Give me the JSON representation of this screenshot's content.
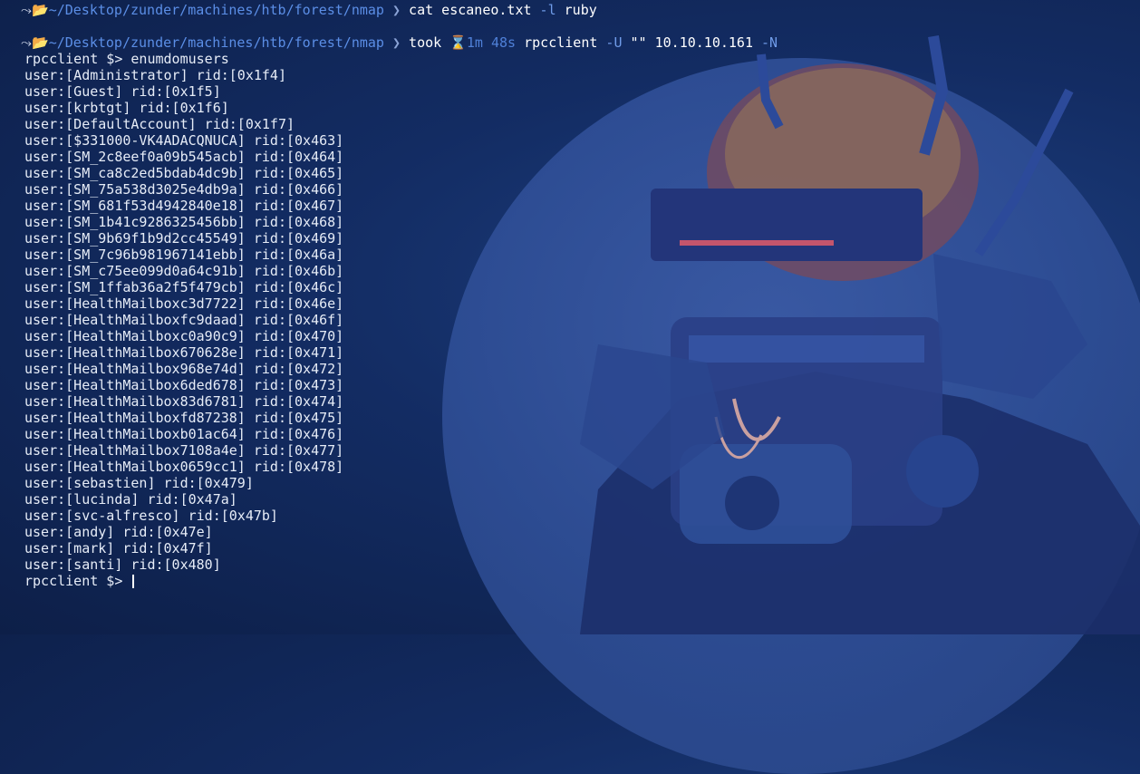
{
  "prompt": {
    "icon": "⤳📂",
    "path": "~/Desktop/zunder/machines/htb/forest/nmap",
    "chevron": "❯"
  },
  "commands": [
    {
      "name": "cat",
      "args": "escaneo.txt",
      "flag": "-l",
      "flag_value": "ruby"
    },
    {
      "took_label": "took",
      "hourglass": "⌛",
      "duration": "1m 48s",
      "name": "rpcclient",
      "flag1": "-U",
      "arg1": "\"\"",
      "ip": "10.10.10.161",
      "flag2": "-N"
    }
  ],
  "rpc_prompt": "rpcclient $>",
  "rpc_command": "enumdomusers",
  "users": [
    "user:[Administrator] rid:[0x1f4]",
    "user:[Guest] rid:[0x1f5]",
    "user:[krbtgt] rid:[0x1f6]",
    "user:[DefaultAccount] rid:[0x1f7]",
    "user:[$331000-VK4ADACQNUCA] rid:[0x463]",
    "user:[SM_2c8eef0a09b545acb] rid:[0x464]",
    "user:[SM_ca8c2ed5bdab4dc9b] rid:[0x465]",
    "user:[SM_75a538d3025e4db9a] rid:[0x466]",
    "user:[SM_681f53d4942840e18] rid:[0x467]",
    "user:[SM_1b41c9286325456bb] rid:[0x468]",
    "user:[SM_9b69f1b9d2cc45549] rid:[0x469]",
    "user:[SM_7c96b981967141ebb] rid:[0x46a]",
    "user:[SM_c75ee099d0a64c91b] rid:[0x46b]",
    "user:[SM_1ffab36a2f5f479cb] rid:[0x46c]",
    "user:[HealthMailboxc3d7722] rid:[0x46e]",
    "user:[HealthMailboxfc9daad] rid:[0x46f]",
    "user:[HealthMailboxc0a90c9] rid:[0x470]",
    "user:[HealthMailbox670628e] rid:[0x471]",
    "user:[HealthMailbox968e74d] rid:[0x472]",
    "user:[HealthMailbox6ded678] rid:[0x473]",
    "user:[HealthMailbox83d6781] rid:[0x474]",
    "user:[HealthMailboxfd87238] rid:[0x475]",
    "user:[HealthMailboxb01ac64] rid:[0x476]",
    "user:[HealthMailbox7108a4e] rid:[0x477]",
    "user:[HealthMailbox0659cc1] rid:[0x478]",
    "user:[sebastien] rid:[0x479]",
    "user:[lucinda] rid:[0x47a]",
    "user:[svc-alfresco] rid:[0x47b]",
    "user:[andy] rid:[0x47e]",
    "user:[mark] rid:[0x47f]",
    "user:[santi] rid:[0x480]"
  ],
  "colors": {
    "background": "#132c63",
    "path": "#5b8ee6",
    "text": "#e6ecf7"
  }
}
